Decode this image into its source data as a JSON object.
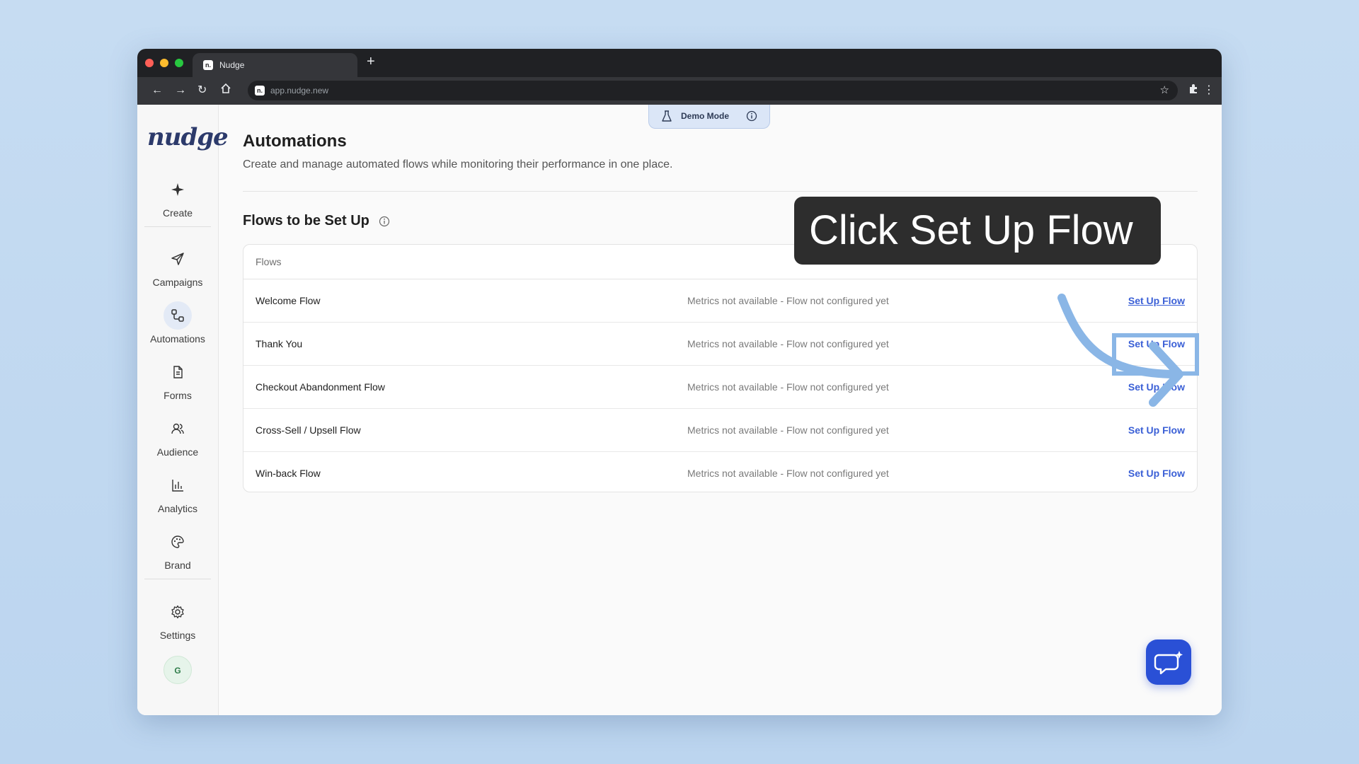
{
  "browser": {
    "tab_title": "Nudge",
    "tab_favicon": "n.",
    "new_tab": "+",
    "url": "app.nudge.new"
  },
  "demo_mode": {
    "label": "Demo Mode"
  },
  "sidebar": {
    "logo": "nudge",
    "items": [
      {
        "label": "Create",
        "icon": "sparkle-icon"
      },
      {
        "label": "Campaigns",
        "icon": "send-icon"
      },
      {
        "label": "Automations",
        "icon": "automation-icon",
        "active": true
      },
      {
        "label": "Forms",
        "icon": "document-icon"
      },
      {
        "label": "Audience",
        "icon": "users-icon"
      },
      {
        "label": "Analytics",
        "icon": "bar-chart-icon"
      },
      {
        "label": "Brand",
        "icon": "palette-icon"
      },
      {
        "label": "Settings",
        "icon": "gear-icon"
      }
    ],
    "avatar": "G"
  },
  "main": {
    "title": "Automations",
    "description": "Create and manage automated flows while monitoring their performance in one place.",
    "section_title": "Flows to be Set Up",
    "table": {
      "header": "Flows",
      "rows": [
        {
          "name": "Welcome Flow",
          "metrics": "Metrics not available - Flow not configured yet",
          "action": "Set Up Flow"
        },
        {
          "name": "Thank You",
          "metrics": "Metrics not available - Flow not configured yet",
          "action": "Set Up Flow"
        },
        {
          "name": "Checkout Abandonment Flow",
          "metrics": "Metrics not available - Flow not configured yet",
          "action": "Set Up Flow"
        },
        {
          "name": "Cross-Sell / Upsell Flow",
          "metrics": "Metrics not available - Flow not configured yet",
          "action": "Set Up Flow"
        },
        {
          "name": "Win-back Flow",
          "metrics": "Metrics not available - Flow not configured yet",
          "action": "Set Up Flow"
        }
      ]
    }
  },
  "overlay": {
    "callout": "Click Set Up Flow",
    "highlight_color": "#8ab6e6"
  },
  "colors": {
    "accent": "#3a5fd6",
    "chat_button": "#2a50d6"
  }
}
